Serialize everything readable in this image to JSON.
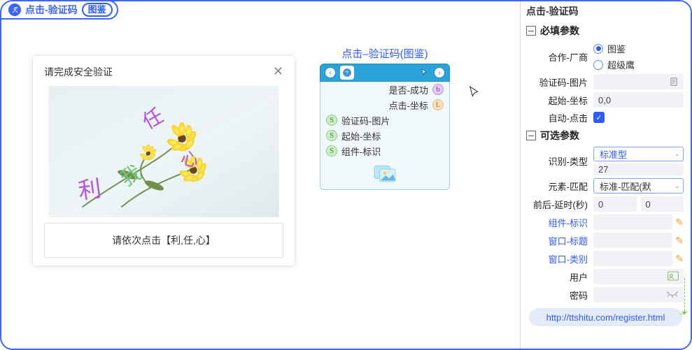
{
  "title": {
    "icon_name": "person-icon",
    "text": "点击-验证码",
    "badge": "图鉴"
  },
  "captcha": {
    "header": "请完成安全验证",
    "footer": "请依次点击【利,任,心】",
    "words": [
      "利",
      "任",
      "心",
      "我"
    ]
  },
  "flow": {
    "title": "点击–验证码(图鉴)",
    "outputs": [
      {
        "label": "是否-成功",
        "chip": "b"
      },
      {
        "label": "点击-坐标",
        "chip": "L"
      }
    ],
    "inputs": [
      {
        "label": "验证码-图片",
        "chip": "S"
      },
      {
        "label": "起始-坐标",
        "chip": "S"
      },
      {
        "label": "组件-标识",
        "chip": "S"
      }
    ]
  },
  "sidebar": {
    "title": "点击-验证码",
    "section1": "必填参数",
    "section2": "可选参数",
    "partner_label": "合作-厂商",
    "partner_options": {
      "opt1": "图鉴",
      "opt2": "超级鹰"
    },
    "captcha_img_label": "验证码-图片",
    "start_coord_label": "起始-坐标",
    "start_coord_value": "0,0",
    "auto_click_label": "自动-点击",
    "recog_type_label": "识别-类型",
    "recog_type_select": "标准型",
    "recog_type_value": "27",
    "element_match_label": "元素-匹配",
    "element_match_value": "标准-匹配(默",
    "delay_label": "前后-延时(秒)",
    "delay_before": "0",
    "delay_after": "0",
    "comp_id_label": "组件-标识",
    "win_title_label": "窗口-标题",
    "win_class_label": "窗口-类别",
    "user_label": "用户",
    "pwd_label": "密码",
    "link": "http://ttshitu.com/register.html"
  }
}
